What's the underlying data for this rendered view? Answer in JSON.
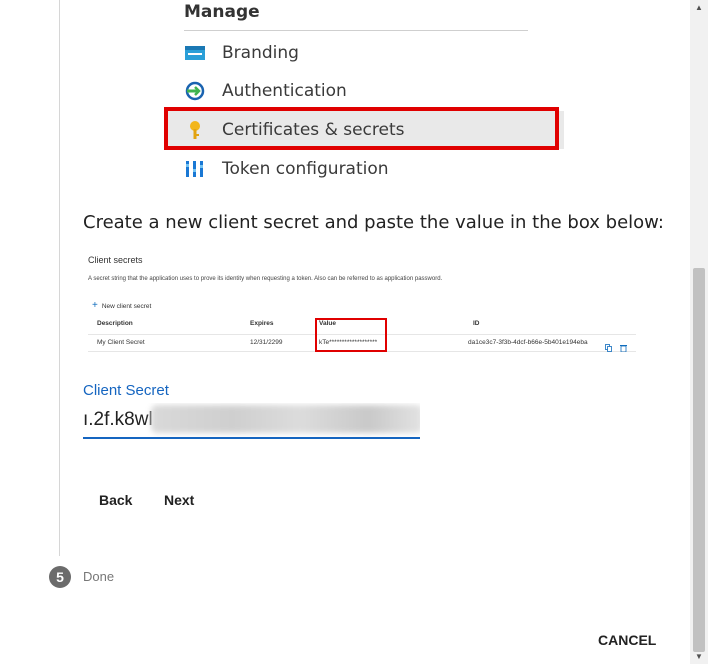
{
  "manage": {
    "title": "Manage",
    "items": [
      {
        "label": "Branding",
        "icon": "branding-icon"
      },
      {
        "label": "Authentication",
        "icon": "authentication-icon"
      },
      {
        "label": "Certificates & secrets",
        "icon": "key-icon"
      },
      {
        "label": "Token configuration",
        "icon": "token-config-icon"
      }
    ],
    "highlight_color": "#e00000"
  },
  "instruction": "Create a new client secret and paste the value in the box below:",
  "secrets_panel": {
    "title": "Client secrets",
    "description": "A secret string that the application uses to prove its identity when requesting a token. Also can be referred to as application password.",
    "new_secret_label": "New client secret",
    "columns": [
      "Description",
      "Expires",
      "Value",
      "ID"
    ],
    "row": {
      "description": "My Client Secret",
      "expires": "12/31/2299",
      "value": "kTe*******************",
      "id": "da1ce3c7-3f3b-4dcf-b66e-5b401e194eba"
    }
  },
  "client_secret": {
    "label": "Client Secret",
    "value_visible": "ı.2f.k8wl"
  },
  "buttons": {
    "back": "Back",
    "next": "Next",
    "cancel": "CANCEL"
  },
  "step": {
    "number": "5",
    "label": "Done"
  },
  "colors": {
    "accent": "#1565c0",
    "highlight": "#e00000"
  }
}
